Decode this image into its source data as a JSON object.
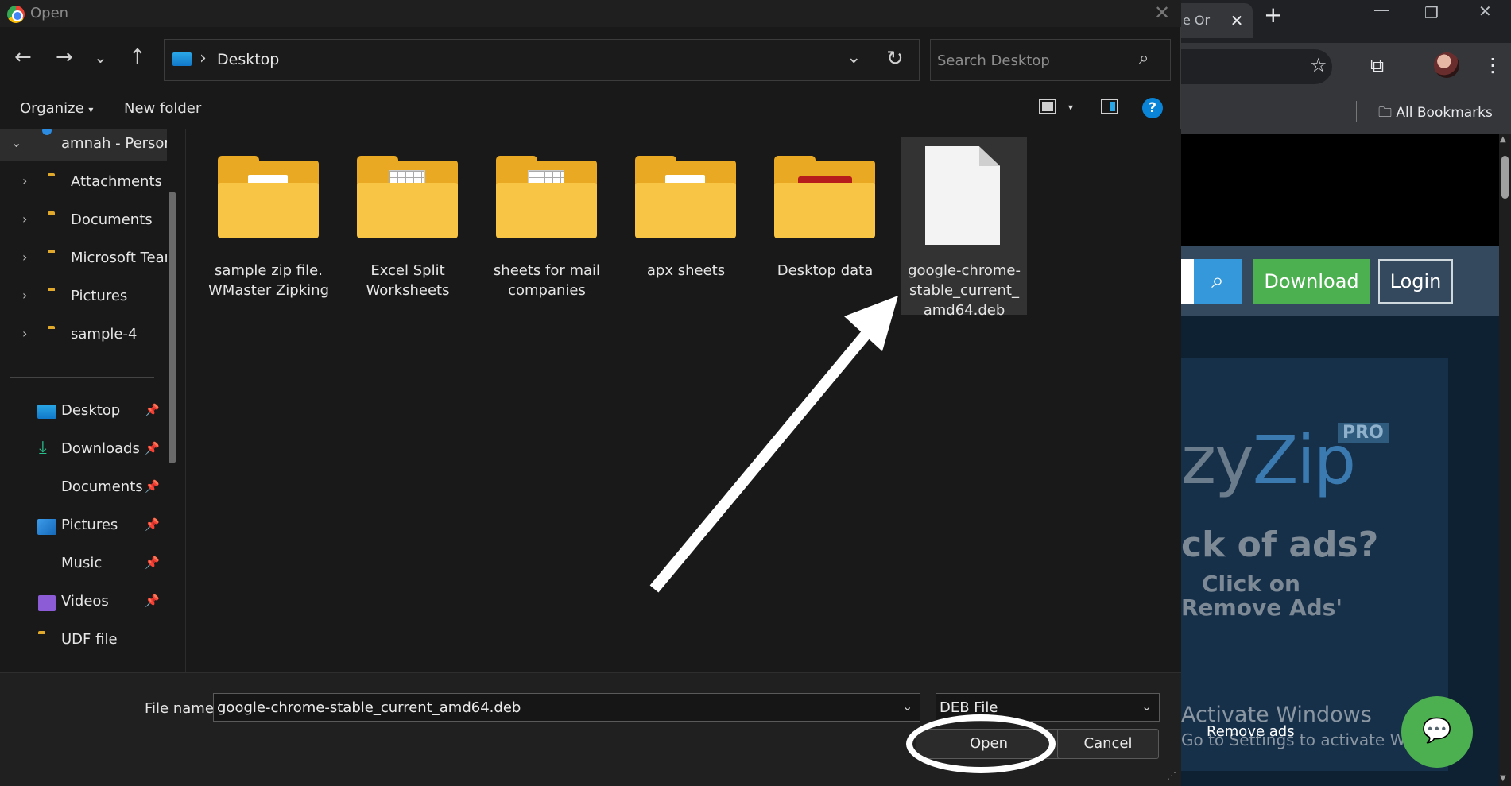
{
  "dialog": {
    "title": "Open",
    "location": "Desktop",
    "search_placeholder": "Search Desktop",
    "organize_label": "Organize",
    "new_folder_label": "New folder",
    "help_label": "?"
  },
  "sidebar": {
    "tree": [
      {
        "label": "amnah - Personal",
        "icon": "onedrive-cloud-icon",
        "expanded": true
      },
      {
        "label": "Attachments",
        "icon": "folder-icon"
      },
      {
        "label": "Documents",
        "icon": "folder-icon"
      },
      {
        "label": "Microsoft Teams",
        "icon": "folder-icon"
      },
      {
        "label": "Pictures",
        "icon": "folder-icon"
      },
      {
        "label": "sample-4",
        "icon": "folder-icon"
      }
    ],
    "quick_access": [
      {
        "label": "Desktop",
        "icon": "desktop-icon",
        "pinned": true
      },
      {
        "label": "Downloads",
        "icon": "download-icon",
        "pinned": true
      },
      {
        "label": "Documents",
        "icon": "documents-icon",
        "pinned": true
      },
      {
        "label": "Pictures",
        "icon": "pictures-icon",
        "pinned": true
      },
      {
        "label": "Music",
        "icon": "music-icon",
        "pinned": true
      },
      {
        "label": "Videos",
        "icon": "videos-icon",
        "pinned": true
      },
      {
        "label": "UDF file",
        "icon": "folder-icon",
        "pinned": false
      }
    ]
  },
  "files": [
    {
      "label": "sample zip file. WMaster Zipking",
      "type": "folder"
    },
    {
      "label": "Excel Split Worksheets",
      "type": "folder"
    },
    {
      "label": "sheets for mail companies",
      "type": "folder"
    },
    {
      "label": "apx sheets",
      "type": "folder"
    },
    {
      "label": "Desktop data",
      "type": "folder"
    },
    {
      "label": "google-chrome-stable_current_amd64.deb",
      "type": "file",
      "selected": true
    }
  ],
  "footer": {
    "file_name_label": "File name:",
    "file_name_value": "google-chrome-stable_current_amd64.deb",
    "file_type": "DEB File",
    "open_label": "Open",
    "cancel_label": "Cancel"
  },
  "browser": {
    "tab_title": "e Or",
    "bookmarks_label": "All Bookmarks",
    "download_label": "Download",
    "login_label": "Login",
    "logo_prefix": "zy",
    "logo_suffix": "Zip",
    "pro_badge": "PRO",
    "ad_line1": "ck of ads?",
    "ad_line2": "Click on",
    "ad_line3": "Remove Ads'",
    "remove_ads": "Remove ads",
    "activate_title": "Activate Windows",
    "activate_sub": "Go to Settings to activate Windows."
  },
  "colors": {
    "dialog_bg": "#191919",
    "accent_blue": "#0a84d6",
    "folder_yellow": "#f8c545",
    "download_green": "#4caf50",
    "search_blue": "#3498db"
  }
}
